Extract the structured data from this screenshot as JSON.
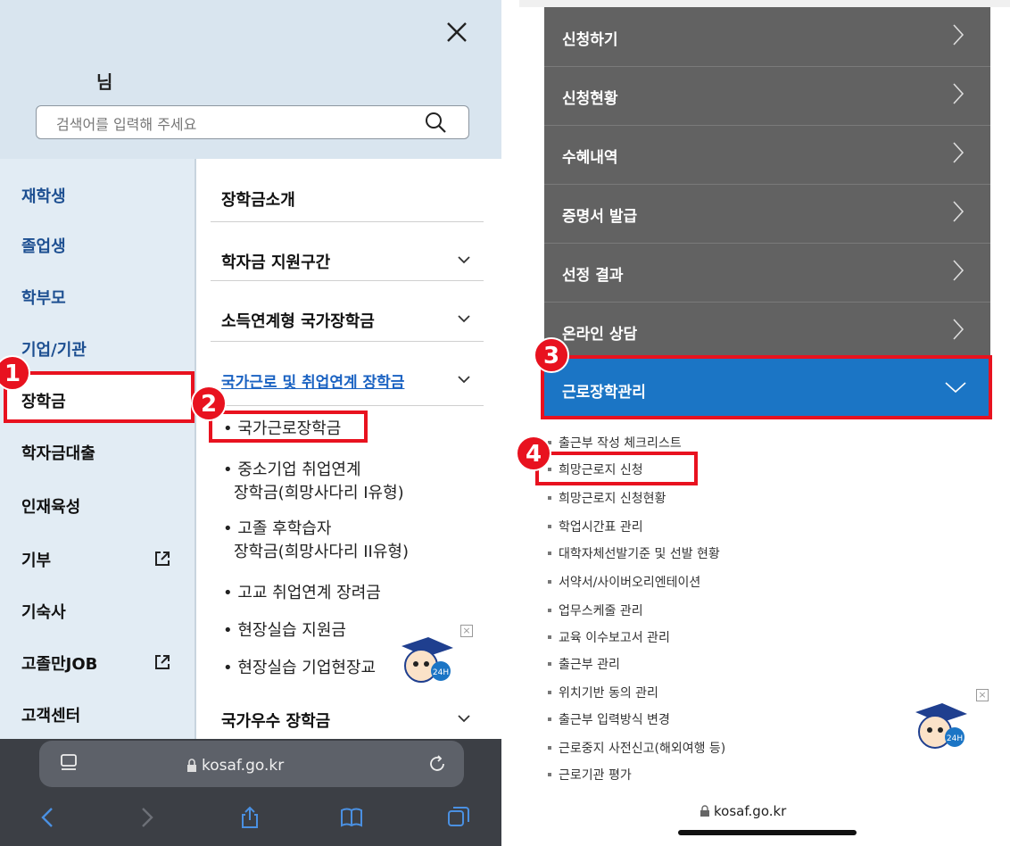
{
  "left": {
    "user_suffix": "님",
    "search": {
      "placeholder": "검색어를 입력해 주세요"
    },
    "nav_items": [
      "재학생",
      "졸업생",
      "학부모",
      "기업/기관",
      "장학금",
      "학자금대출",
      "인재육성",
      "기부",
      "기숙사",
      "고졸만JOB",
      "고객센터"
    ],
    "menu": {
      "intro": "장학금소개",
      "support": "학자금 지원구간",
      "income": "소득연계형 국가장학금",
      "work": "국가근로 및 취업연계 장학금",
      "national": "국가우수 장학금"
    },
    "submenu": {
      "s1": "국가근로장학금",
      "s2a": "중소기업 취업연계",
      "s2b": "장학금(희망사다리 I유형)",
      "s3a": "고졸 후학습자",
      "s3b": "장학금(희망사다리 II유형)",
      "s4": "고교 취업연계 장려금",
      "s5": "현장실습 지원금",
      "s6": "현장실습 기업현장교"
    },
    "url": "kosaf.go.kr"
  },
  "right": {
    "menu_items": [
      "신청하기",
      "신청현황",
      "수혜내역",
      "증명서 발급",
      "선정 결과",
      "온라인 상담"
    ],
    "active_menu": "근로장학관리",
    "sub_items": [
      "출근부 작성 체크리스트",
      "희망근로지 신청",
      "희망근로지 신청현황",
      "학업시간표 관리",
      "대학자체선발기준 및 선발 현황",
      "서약서/사이버오리엔테이션",
      "업무스케줄 관리",
      "교육 이수보고서 관리",
      "출근부 관리",
      "위치기반 동의 관리",
      "출근부 입력방식 변경",
      "근로중지 사전신고(해외여행 등)",
      "근로기관 평가"
    ],
    "url": "kosaf.go.kr"
  },
  "badges": [
    "1",
    "2",
    "3",
    "4"
  ],
  "mascot_label": "24H",
  "colors": {
    "accent_red": "#e8121f",
    "active_blue": "#1b75c5",
    "menu_gray": "#626262",
    "nav_blue": "#1d4f91"
  }
}
